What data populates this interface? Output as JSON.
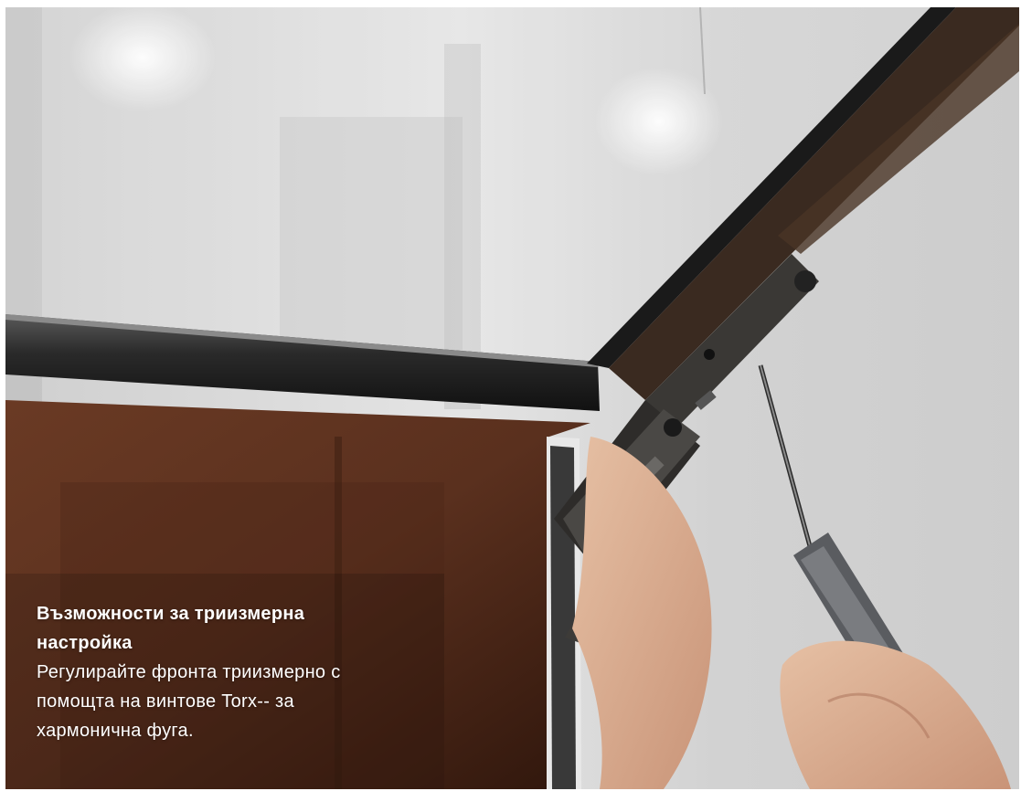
{
  "caption": {
    "title": "Възможности за триизмерна настройка",
    "body": "Регулирайте фронта триизмерно с помощта на винтове Torx-- за хармонична фуга."
  },
  "colors": {
    "background": "#cfcfcf",
    "wall": "#d9d9d9",
    "glass_frame": "#1c1c1c",
    "wood": "#5a3020",
    "hinge": "#3a3835",
    "text": "#ffffff"
  },
  "icons": {
    "screwdriver": "screwdriver-icon",
    "hinge": "hinge-icon"
  }
}
